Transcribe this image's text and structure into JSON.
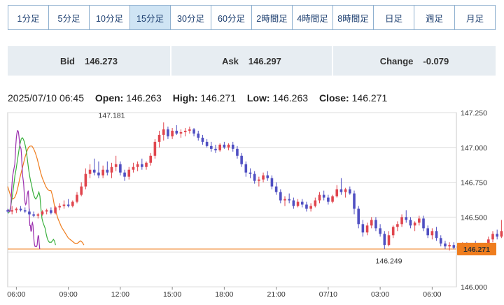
{
  "tabs": [
    "1分足",
    "5分足",
    "10分足",
    "15分足",
    "30分足",
    "60分足",
    "2時間足",
    "4時間足",
    "8時間足",
    "日足",
    "週足",
    "月足"
  ],
  "active_tab": "15分足",
  "quote": {
    "bid_label": "Bid",
    "bid": "146.273",
    "ask_label": "Ask",
    "ask": "146.297",
    "change_label": "Change",
    "change": "-0.079"
  },
  "ohlc": {
    "datetime": "2025/07/10 06:45",
    "open_label": "Open:",
    "open": "146.263",
    "high_label": "High:",
    "high": "146.271",
    "low_label": "Low:",
    "low": "146.263",
    "close_label": "Close:",
    "close": "146.271"
  },
  "colors": {
    "up": "#e0454d",
    "down": "#4f4fc2",
    "ma_short": "#9b2fae",
    "ma_mid": "#38b03c",
    "ma_long": "#ef7d1e",
    "current_price": "#ef7d1e",
    "accent": "#1a3c6e"
  },
  "chart_data": {
    "type": "candlestick",
    "ylim": [
      146.0,
      147.25
    ],
    "y_ticks": [
      "147.250",
      "147.000",
      "146.750",
      "146.500",
      "146.250",
      "146.000"
    ],
    "x_ticks": [
      "06:00",
      "09:00",
      "12:00",
      "15:00",
      "18:00",
      "21:00",
      "07/10",
      "03:00",
      "06:00"
    ],
    "max_annotation": "147.181",
    "min_annotation": "146.249",
    "current_price": "146.271",
    "x_start_hour": 5.5,
    "hours_per_candle": 0.25,
    "candles": [
      [
        146.55,
        146.56,
        146.53,
        146.54
      ],
      [
        146.54,
        146.58,
        146.52,
        146.55
      ],
      [
        146.55,
        146.57,
        146.53,
        146.56
      ],
      [
        146.56,
        146.58,
        146.54,
        146.55
      ],
      [
        146.55,
        146.57,
        146.53,
        146.54
      ],
      [
        146.54,
        146.56,
        146.51,
        146.52
      ],
      [
        146.52,
        146.54,
        146.5,
        146.51
      ],
      [
        146.51,
        146.53,
        146.49,
        146.52
      ],
      [
        146.52,
        146.55,
        146.51,
        146.54
      ],
      [
        146.54,
        146.56,
        146.52,
        146.55
      ],
      [
        146.55,
        146.57,
        146.52,
        146.53
      ],
      [
        146.53,
        146.58,
        146.52,
        146.57
      ],
      [
        146.57,
        146.6,
        146.55,
        146.58
      ],
      [
        146.58,
        146.62,
        146.56,
        146.59
      ],
      [
        146.59,
        146.63,
        146.57,
        146.58
      ],
      [
        146.58,
        146.62,
        146.57,
        146.61
      ],
      [
        146.61,
        146.68,
        146.6,
        146.66
      ],
      [
        146.66,
        146.75,
        146.65,
        146.72
      ],
      [
        146.72,
        146.85,
        146.7,
        146.81
      ],
      [
        146.81,
        146.88,
        146.78,
        146.84
      ],
      [
        146.84,
        146.92,
        146.8,
        146.82
      ],
      [
        146.82,
        146.9,
        146.78,
        146.8
      ],
      [
        146.8,
        146.87,
        146.78,
        146.84
      ],
      [
        146.84,
        146.9,
        146.8,
        146.82
      ],
      [
        146.82,
        146.89,
        146.78,
        146.86
      ],
      [
        146.86,
        146.94,
        146.83,
        146.88
      ],
      [
        146.88,
        146.9,
        146.8,
        146.82
      ],
      [
        146.82,
        146.84,
        146.76,
        146.79
      ],
      [
        146.79,
        146.86,
        146.77,
        146.84
      ],
      [
        146.84,
        146.89,
        146.82,
        146.86
      ],
      [
        146.86,
        146.9,
        146.83,
        146.88
      ],
      [
        146.88,
        146.92,
        146.84,
        146.86
      ],
      [
        146.86,
        146.9,
        146.84,
        146.89
      ],
      [
        146.89,
        146.96,
        146.87,
        146.94
      ],
      [
        146.94,
        147.06,
        146.92,
        147.04
      ],
      [
        147.04,
        147.12,
        147.0,
        147.09
      ],
      [
        147.09,
        147.18,
        147.05,
        147.13
      ],
      [
        147.13,
        147.15,
        147.06,
        147.08
      ],
      [
        147.08,
        147.14,
        147.06,
        147.12
      ],
      [
        147.12,
        147.16,
        147.09,
        147.1
      ],
      [
        147.1,
        147.13,
        147.07,
        147.11
      ],
      [
        147.11,
        147.14,
        147.08,
        147.12
      ],
      [
        147.12,
        147.15,
        147.1,
        147.13
      ],
      [
        147.13,
        147.14,
        147.08,
        147.1
      ],
      [
        147.1,
        147.12,
        147.05,
        147.07
      ],
      [
        147.07,
        147.09,
        147.02,
        147.04
      ],
      [
        147.04,
        147.06,
        147.0,
        147.01
      ],
      [
        147.01,
        147.04,
        146.97,
        146.99
      ],
      [
        146.99,
        147.02,
        146.96,
        146.98
      ],
      [
        146.98,
        147.03,
        146.97,
        147.02
      ],
      [
        147.02,
        147.04,
        146.99,
        147.0
      ],
      [
        147.0,
        147.03,
        146.98,
        147.02
      ],
      [
        147.02,
        147.04,
        146.97,
        146.99
      ],
      [
        146.99,
        147.01,
        146.92,
        146.94
      ],
      [
        146.94,
        146.96,
        146.86,
        146.88
      ],
      [
        146.88,
        146.9,
        146.79,
        146.82
      ],
      [
        146.82,
        146.85,
        146.78,
        146.81
      ],
      [
        146.81,
        146.83,
        146.74,
        146.76
      ],
      [
        146.76,
        146.79,
        146.72,
        146.77
      ],
      [
        146.77,
        146.82,
        146.75,
        146.8
      ],
      [
        146.8,
        146.83,
        146.76,
        146.78
      ],
      [
        146.78,
        146.8,
        146.7,
        146.72
      ],
      [
        146.72,
        146.75,
        146.66,
        146.68
      ],
      [
        146.68,
        146.7,
        146.6,
        146.62
      ],
      [
        146.62,
        146.65,
        146.58,
        146.63
      ],
      [
        146.63,
        146.67,
        146.6,
        146.62
      ],
      [
        146.62,
        146.64,
        146.56,
        146.58
      ],
      [
        146.58,
        146.63,
        146.57,
        146.61
      ],
      [
        146.61,
        146.63,
        146.57,
        146.59
      ],
      [
        146.59,
        146.61,
        146.54,
        146.56
      ],
      [
        146.56,
        146.6,
        146.54,
        146.58
      ],
      [
        146.58,
        146.64,
        146.57,
        146.62
      ],
      [
        146.62,
        146.68,
        146.6,
        146.66
      ],
      [
        146.66,
        146.69,
        146.62,
        146.64
      ],
      [
        146.64,
        146.66,
        146.59,
        146.61
      ],
      [
        146.61,
        146.66,
        146.6,
        146.65
      ],
      [
        146.65,
        146.73,
        146.64,
        146.7
      ],
      [
        146.7,
        146.78,
        146.66,
        146.68
      ],
      [
        146.68,
        146.71,
        146.64,
        146.7
      ],
      [
        146.7,
        146.72,
        146.66,
        146.67
      ],
      [
        146.67,
        146.69,
        146.52,
        146.56
      ],
      [
        146.56,
        146.58,
        146.42,
        146.45
      ],
      [
        146.45,
        146.48,
        146.36,
        146.39
      ],
      [
        146.39,
        146.46,
        146.37,
        146.44
      ],
      [
        146.44,
        146.5,
        146.42,
        146.48
      ],
      [
        146.48,
        146.5,
        146.4,
        146.42
      ],
      [
        146.42,
        146.45,
        146.36,
        146.38
      ],
      [
        146.38,
        146.4,
        146.27,
        146.3
      ],
      [
        146.3,
        146.4,
        146.29,
        146.37
      ],
      [
        146.37,
        146.44,
        146.35,
        146.43
      ],
      [
        146.43,
        146.47,
        146.4,
        146.45
      ],
      [
        146.45,
        146.52,
        146.43,
        146.5
      ],
      [
        146.5,
        146.55,
        146.46,
        146.48
      ],
      [
        146.48,
        146.5,
        146.42,
        146.44
      ],
      [
        146.44,
        146.47,
        146.4,
        146.46
      ],
      [
        146.46,
        146.51,
        146.44,
        146.49
      ],
      [
        146.49,
        146.51,
        146.4,
        146.42
      ],
      [
        146.42,
        146.44,
        146.35,
        146.37
      ],
      [
        146.37,
        146.42,
        146.34,
        146.4
      ],
      [
        146.4,
        146.43,
        146.33,
        146.35
      ],
      [
        146.35,
        146.37,
        146.29,
        146.31
      ],
      [
        146.31,
        146.33,
        146.27,
        146.29
      ],
      [
        146.29,
        146.32,
        146.26,
        146.3
      ],
      [
        146.3,
        146.32,
        146.27,
        146.28
      ],
      [
        146.28,
        146.31,
        146.25,
        146.29
      ],
      [
        146.29,
        146.32,
        146.26,
        146.3
      ],
      [
        146.3,
        146.32,
        146.27,
        146.29
      ],
      [
        146.29,
        146.31,
        146.27,
        146.3
      ],
      [
        146.3,
        146.33,
        146.28,
        146.29
      ],
      [
        146.29,
        146.31,
        146.27,
        146.28
      ],
      [
        146.28,
        146.31,
        146.27,
        146.3
      ],
      [
        146.3,
        146.36,
        146.29,
        146.34
      ],
      [
        146.34,
        146.4,
        146.32,
        146.38
      ],
      [
        146.38,
        146.41,
        146.34,
        146.36
      ],
      [
        146.36,
        146.48,
        146.35,
        146.4
      ],
      [
        146.4,
        146.43,
        146.32,
        146.34
      ],
      [
        146.34,
        146.36,
        146.3,
        146.32
      ],
      [
        146.32,
        146.33,
        146.28,
        146.29
      ],
      [
        146.29,
        146.3,
        146.26,
        146.27
      ],
      [
        146.27,
        146.28,
        146.25,
        146.26
      ],
      [
        146.26,
        146.28,
        146.26,
        146.27
      ]
    ],
    "ma_short": [
      [
        146.53,
        146.555
      ],
      [
        146.56,
        146.55
      ],
      [
        146.59,
        146.54
      ],
      [
        146.62,
        146.54
      ],
      [
        146.65,
        146.55
      ],
      [
        146.68,
        146.58
      ],
      [
        146.7,
        146.62
      ],
      [
        146.72,
        146.68
      ],
      [
        146.75,
        146.74
      ],
      [
        146.78,
        146.79
      ],
      [
        146.82,
        146.82
      ],
      [
        146.85,
        146.84
      ],
      [
        146.88,
        146.86
      ],
      [
        146.91,
        146.88
      ],
      [
        146.94,
        146.95
      ],
      [
        146.97,
        147.02
      ],
      [
        147.0,
        147.07
      ],
      [
        147.03,
        147.1
      ],
      [
        147.06,
        147.12
      ],
      [
        147.09,
        147.12
      ],
      [
        147.12,
        147.11
      ],
      [
        147.15,
        147.08
      ],
      [
        147.18,
        147.04
      ],
      [
        147.21,
        147.01
      ],
      [
        147.24,
        147.0
      ],
      [
        147.27,
        146.99
      ],
      [
        147.3,
        146.94
      ],
      [
        147.33,
        146.86
      ],
      [
        147.36,
        146.8
      ],
      [
        147.39,
        146.77
      ],
      [
        147.42,
        146.74
      ],
      [
        147.45,
        146.68
      ],
      [
        147.48,
        146.63
      ],
      [
        147.51,
        146.6
      ],
      [
        147.54,
        146.59
      ],
      [
        147.57,
        146.6
      ],
      [
        147.6,
        146.63
      ],
      [
        147.63,
        146.66
      ],
      [
        147.66,
        146.68
      ],
      [
        147.69,
        146.69
      ],
      [
        147.72,
        146.62
      ],
      [
        147.75,
        146.5
      ],
      [
        147.78,
        146.44
      ],
      [
        147.81,
        146.44
      ],
      [
        147.84,
        146.4
      ],
      [
        147.87,
        146.4
      ],
      [
        147.9,
        146.45
      ],
      [
        147.93,
        146.46
      ],
      [
        147.96,
        146.44
      ],
      [
        147.99,
        146.38
      ],
      [
        148.02,
        146.33
      ],
      [
        148.05,
        146.3
      ],
      [
        148.08,
        146.29
      ],
      [
        148.11,
        146.29
      ],
      [
        148.14,
        146.29
      ],
      [
        148.17,
        146.29
      ],
      [
        148.2,
        146.3
      ],
      [
        148.23,
        146.34
      ],
      [
        148.26,
        146.37
      ],
      [
        148.29,
        146.36
      ],
      [
        148.32,
        146.31
      ],
      [
        148.35,
        146.27
      ]
    ],
    "ma_mid": [
      [
        146.5,
        146.53
      ],
      [
        146.56,
        146.53
      ],
      [
        146.62,
        146.55
      ],
      [
        146.68,
        146.58
      ],
      [
        146.74,
        146.63
      ],
      [
        146.8,
        146.68
      ],
      [
        146.86,
        146.74
      ],
      [
        146.92,
        146.8
      ],
      [
        146.98,
        146.84
      ],
      [
        147.04,
        146.89
      ],
      [
        147.1,
        146.94
      ],
      [
        147.16,
        146.99
      ],
      [
        147.22,
        147.03
      ],
      [
        147.28,
        147.06
      ],
      [
        147.34,
        147.07
      ],
      [
        147.4,
        147.06
      ],
      [
        147.46,
        147.04
      ],
      [
        147.52,
        147.01
      ],
      [
        147.58,
        146.97
      ],
      [
        147.64,
        146.91
      ],
      [
        147.7,
        146.85
      ],
      [
        147.76,
        146.8
      ],
      [
        147.82,
        146.76
      ],
      [
        147.88,
        146.73
      ],
      [
        147.94,
        146.69
      ],
      [
        148.0,
        146.66
      ],
      [
        148.06,
        146.64
      ],
      [
        148.12,
        146.63
      ],
      [
        148.18,
        146.64
      ],
      [
        148.24,
        146.66
      ],
      [
        148.3,
        146.68
      ],
      [
        148.36,
        146.65
      ],
      [
        148.42,
        146.56
      ],
      [
        148.48,
        146.49
      ],
      [
        148.54,
        146.46
      ],
      [
        148.6,
        146.44
      ],
      [
        148.66,
        146.42
      ],
      [
        148.72,
        146.38
      ],
      [
        148.78,
        146.35
      ],
      [
        148.84,
        146.33
      ],
      [
        148.9,
        146.32
      ],
      [
        148.96,
        146.32
      ],
      [
        149.02,
        146.32
      ],
      [
        149.08,
        146.33
      ],
      [
        149.14,
        146.34
      ],
      [
        149.2,
        146.33
      ],
      [
        149.26,
        146.3
      ]
    ],
    "ma_long": [
      [
        146.5,
        146.72
      ],
      [
        146.6,
        146.68
      ],
      [
        146.7,
        146.64
      ],
      [
        146.8,
        146.63
      ],
      [
        146.9,
        146.64
      ],
      [
        147.0,
        146.67
      ],
      [
        147.1,
        146.72
      ],
      [
        147.2,
        146.78
      ],
      [
        147.3,
        146.83
      ],
      [
        147.4,
        146.88
      ],
      [
        147.5,
        146.93
      ],
      [
        147.6,
        146.97
      ],
      [
        147.7,
        147.0
      ],
      [
        147.8,
        147.01
      ],
      [
        147.9,
        147.01
      ],
      [
        148.0,
        146.99
      ],
      [
        148.1,
        146.96
      ],
      [
        148.2,
        146.92
      ],
      [
        148.3,
        146.87
      ],
      [
        148.4,
        146.82
      ],
      [
        148.5,
        146.78
      ],
      [
        148.6,
        146.75
      ],
      [
        148.7,
        146.72
      ],
      [
        148.8,
        146.7
      ],
      [
        148.9,
        146.69
      ],
      [
        149.0,
        146.69
      ],
      [
        149.1,
        146.65
      ],
      [
        149.2,
        146.58
      ],
      [
        149.3,
        146.53
      ],
      [
        149.4,
        146.49
      ],
      [
        149.5,
        146.46
      ],
      [
        149.6,
        146.43
      ],
      [
        149.7,
        146.41
      ],
      [
        149.8,
        146.39
      ],
      [
        149.9,
        146.37
      ],
      [
        150.0,
        146.35
      ],
      [
        150.1,
        146.34
      ],
      [
        150.2,
        146.33
      ],
      [
        150.3,
        146.32
      ],
      [
        150.4,
        146.31
      ],
      [
        150.5,
        146.31
      ],
      [
        150.6,
        146.32
      ],
      [
        150.7,
        146.33
      ],
      [
        150.8,
        146.32
      ],
      [
        150.9,
        146.3
      ]
    ]
  }
}
